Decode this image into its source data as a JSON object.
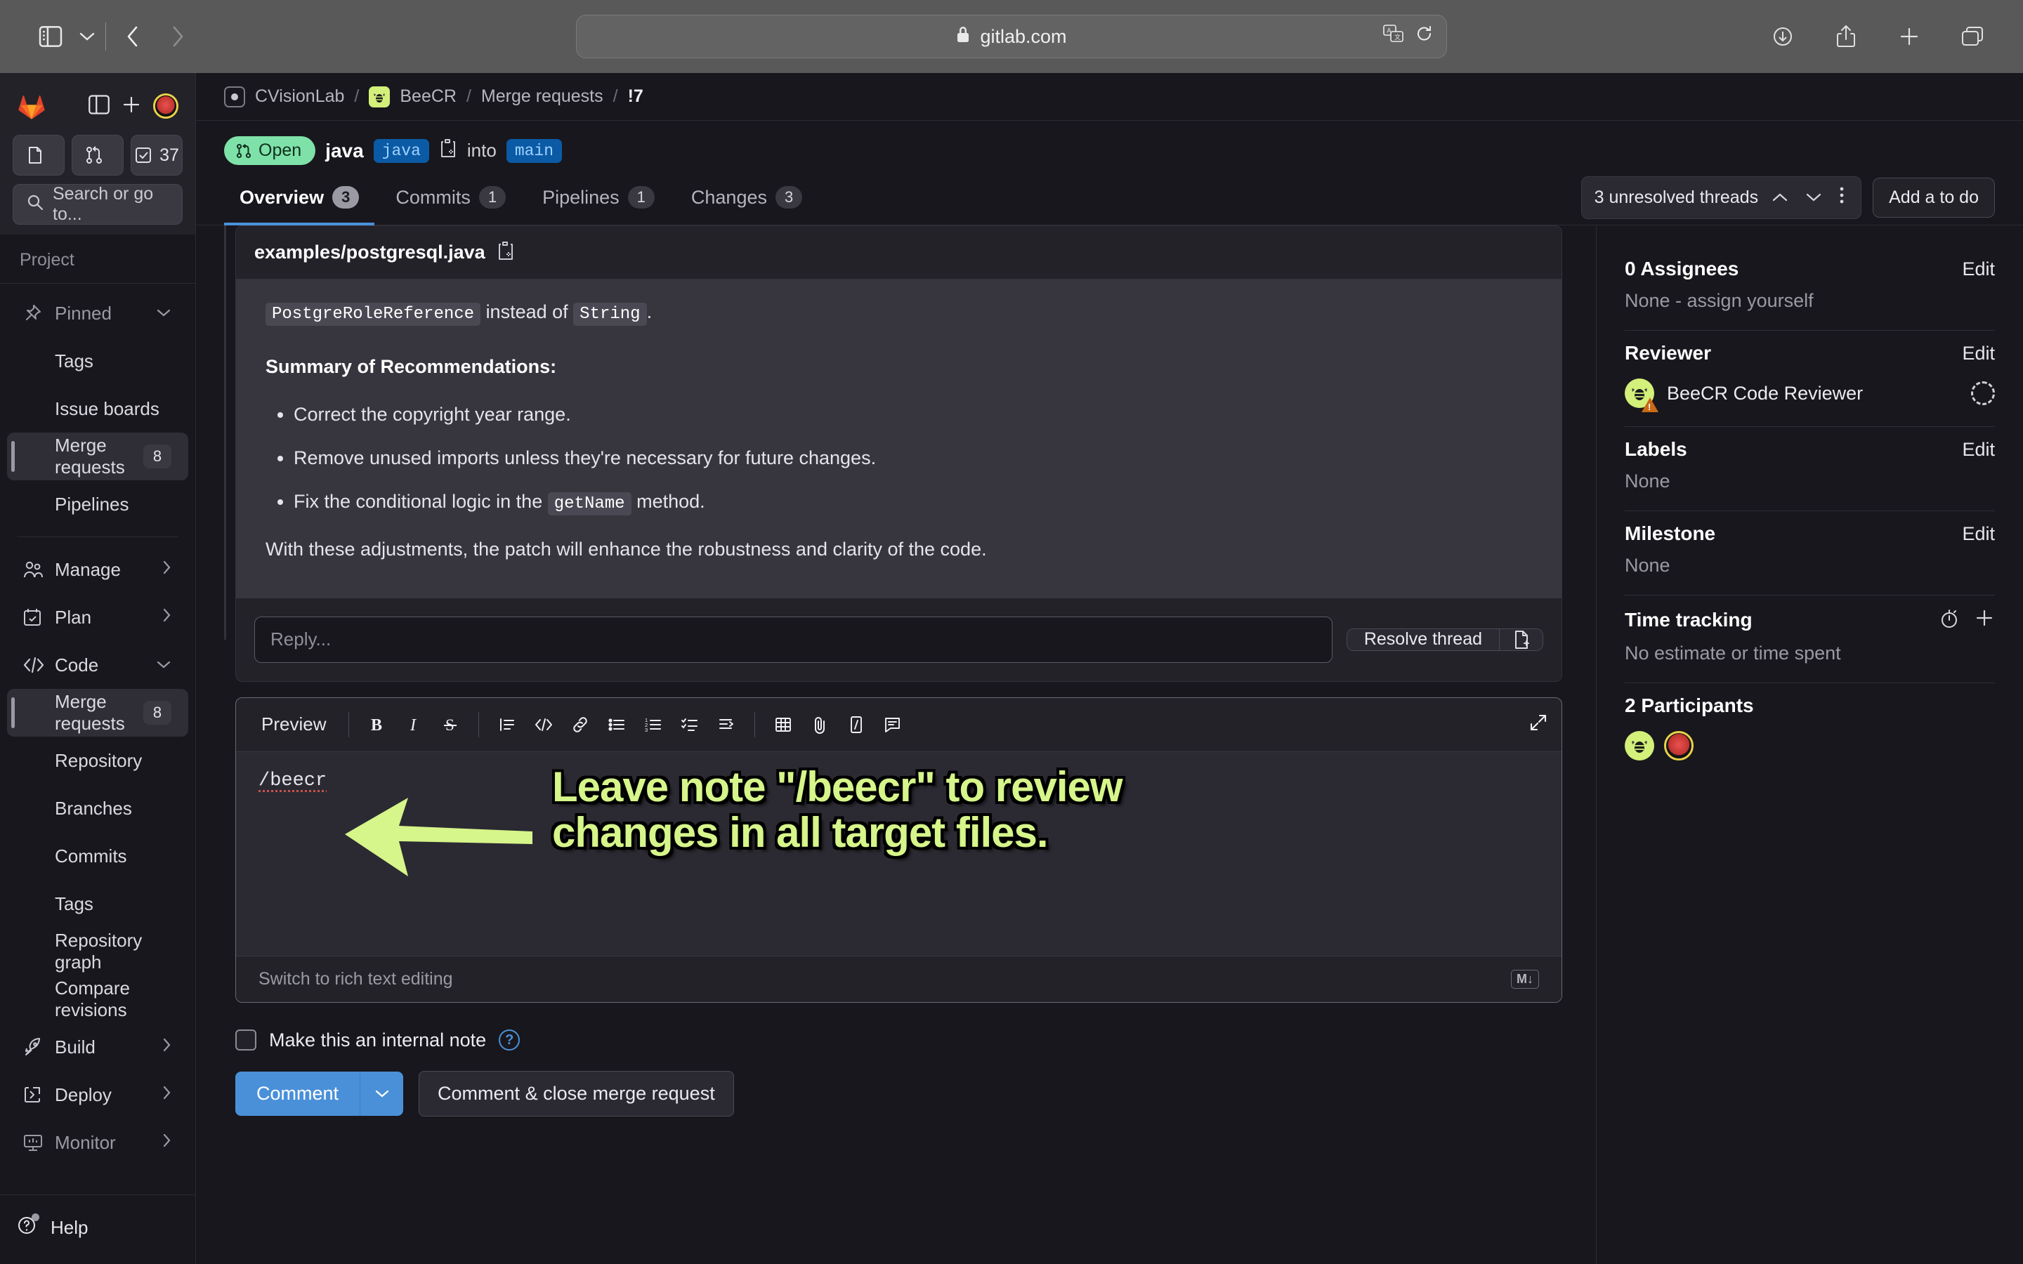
{
  "browser": {
    "url": "gitlab.com",
    "lock_icon": "lock-icon",
    "back_icon": "back-arrow-icon",
    "forward_icon": "forward-arrow-icon",
    "sidebar_toggle_icon": "sidebar-toggle-icon",
    "tab_overview_chevron_icon": "chevron-down-icon",
    "translate_icon": "translate-icon",
    "reload_icon": "reload-icon",
    "downloads_icon": "downloads-icon",
    "share_icon": "share-icon",
    "new_tab_icon": "plus-icon",
    "tabs_icon": "tab-overview-icon"
  },
  "sidebar": {
    "logo_icon": "gitlab-logo-icon",
    "panel_toggle_icon": "panel-toggle-icon",
    "create_new_icon": "plus-icon",
    "avatar_icon": "user-avatar",
    "pills": [
      {
        "name": "issues-pill",
        "icon": "issue-icon",
        "count": ""
      },
      {
        "name": "merge-requests-pill",
        "icon": "merge-request-icon",
        "count": ""
      },
      {
        "name": "todos-pill",
        "icon": "todo-check-icon",
        "count": "37"
      }
    ],
    "search_placeholder": "Search or go to...",
    "search_icon": "search-icon",
    "section_title": "Project",
    "items": [
      {
        "label": "Pinned",
        "icon": "pin-icon",
        "badge": "",
        "chevron": "chevron-down-icon",
        "level": "top",
        "muted": true,
        "active": false
      },
      {
        "label": "Tags",
        "icon": "",
        "badge": "",
        "chevron": "",
        "level": "sub",
        "muted": false,
        "active": false
      },
      {
        "label": "Issue boards",
        "icon": "",
        "badge": "",
        "chevron": "",
        "level": "sub",
        "muted": false,
        "active": false
      },
      {
        "label": "Merge requests",
        "icon": "",
        "badge": "8",
        "chevron": "",
        "level": "sub",
        "muted": false,
        "active": true
      },
      {
        "label": "Pipelines",
        "icon": "",
        "badge": "",
        "chevron": "",
        "level": "sub",
        "muted": false,
        "active": false
      },
      {
        "label": "Manage",
        "icon": "users-icon",
        "badge": "",
        "chevron": "chevron-right-icon",
        "level": "top",
        "muted": false,
        "active": false
      },
      {
        "label": "Plan",
        "icon": "calendar-icon",
        "badge": "",
        "chevron": "chevron-right-icon",
        "level": "top",
        "muted": false,
        "active": false
      },
      {
        "label": "Code",
        "icon": "code-icon",
        "badge": "",
        "chevron": "chevron-down-icon",
        "level": "top",
        "muted": false,
        "active": false
      },
      {
        "label": "Merge requests",
        "icon": "",
        "badge": "8",
        "chevron": "",
        "level": "sub",
        "muted": false,
        "active": true
      },
      {
        "label": "Repository",
        "icon": "",
        "badge": "",
        "chevron": "",
        "level": "sub",
        "muted": false,
        "active": false
      },
      {
        "label": "Branches",
        "icon": "",
        "badge": "",
        "chevron": "",
        "level": "sub",
        "muted": false,
        "active": false
      },
      {
        "label": "Commits",
        "icon": "",
        "badge": "",
        "chevron": "",
        "level": "sub",
        "muted": false,
        "active": false
      },
      {
        "label": "Tags",
        "icon": "",
        "badge": "",
        "chevron": "",
        "level": "sub",
        "muted": false,
        "active": false
      },
      {
        "label": "Repository graph",
        "icon": "",
        "badge": "",
        "chevron": "",
        "level": "sub",
        "muted": false,
        "active": false
      },
      {
        "label": "Compare revisions",
        "icon": "",
        "badge": "",
        "chevron": "",
        "level": "sub",
        "muted": false,
        "active": false
      },
      {
        "label": "Build",
        "icon": "rocket-icon",
        "badge": "",
        "chevron": "chevron-right-icon",
        "level": "top",
        "muted": false,
        "active": false
      },
      {
        "label": "Deploy",
        "icon": "deploy-icon",
        "badge": "",
        "chevron": "chevron-right-icon",
        "level": "top",
        "muted": false,
        "active": false
      },
      {
        "label": "Monitor",
        "icon": "monitor-icon",
        "badge": "",
        "chevron": "chevron-right-icon",
        "level": "top",
        "muted": true,
        "active": false
      }
    ],
    "help_label": "Help",
    "help_icon": "help-circle-icon"
  },
  "breadcrumb": {
    "group": "CVisionLab",
    "project": "BeeCR",
    "section": "Merge requests",
    "current": "!7",
    "separator": "/",
    "group_icon": "project-avatar-icon",
    "project_icon": "bee-avatar-icon"
  },
  "merge_request": {
    "status": "Open",
    "status_icon": "merge-request-open-icon",
    "source_branch_title": "java",
    "source_branch_chip": "java",
    "copy_icon": "copy-branch-icon",
    "into_word": "into",
    "target_branch_chip": "main"
  },
  "tabs": [
    {
      "label": "Overview",
      "count": "3",
      "active": true
    },
    {
      "label": "Commits",
      "count": "1",
      "active": false
    },
    {
      "label": "Pipelines",
      "count": "1",
      "active": false
    },
    {
      "label": "Changes",
      "count": "3",
      "active": false
    }
  ],
  "tabs_right": {
    "threads_text": "3 unresolved threads",
    "prev_icon": "chevron-up-icon",
    "next_icon": "chevron-down-icon",
    "more_icon": "ellipsis-vertical-icon",
    "todo_button": "Add a to do"
  },
  "discussion": {
    "filename": "examples/postgresql.java",
    "copy_icon": "copy-path-icon",
    "paragraph_1_code_1": "PostgreRoleReference",
    "paragraph_1_mid": "instead of",
    "paragraph_1_code_2": "String",
    "paragraph_1_end": ".",
    "summary_heading": "Summary of Recommendations:",
    "bullets": [
      {
        "pre": "Correct the copyright year range.",
        "code": "",
        "post": ""
      },
      {
        "pre": "Remove unused imports unless they're necessary for future changes.",
        "code": "",
        "post": ""
      },
      {
        "pre": "Fix the conditional logic in the",
        "code": "getName",
        "post": "method."
      }
    ],
    "closing": "With these adjustments, the patch will enhance the robustness and clarity of the code.",
    "reply_placeholder": "Reply...",
    "resolve_label": "Resolve thread",
    "resolve_icon": "resolve-to-issue-icon"
  },
  "editor": {
    "preview_label": "Preview",
    "toolbar_icons": [
      "bold-icon",
      "italic-icon",
      "strikethrough-icon",
      "quote-icon",
      "code-icon",
      "link-icon",
      "bullet-list-icon",
      "numbered-list-icon",
      "task-list-icon",
      "indent-icon",
      "table-icon",
      "attachment-icon",
      "snippet-icon",
      "comment-template-icon"
    ],
    "expand_icon": "expand-fullscreen-icon",
    "content": "/beecr",
    "footer_label": "Switch to rich text editing",
    "markdown_badge": "M↓"
  },
  "annotation": {
    "line1": "Leave note \"/beecr\" to review",
    "line2": "changes in all target files.",
    "arrow_icon": "left-arrow-annotation",
    "color": "#d6f58a"
  },
  "post_controls": {
    "internal_note_label": "Make this an internal note",
    "help_icon": "help-circle-icon",
    "comment_label": "Comment",
    "comment_caret_icon": "chevron-down-icon",
    "close_mr_label": "Comment & close merge request"
  },
  "right_panel": {
    "sections": [
      {
        "title": "0 Assignees",
        "action": "Edit",
        "value": "None - assign yourself",
        "type": "text"
      },
      {
        "title": "Reviewer",
        "action": "Edit",
        "value": "BeeCR Code Reviewer",
        "type": "reviewer"
      },
      {
        "title": "Labels",
        "action": "Edit",
        "value": "None",
        "type": "text"
      },
      {
        "title": "Milestone",
        "action": "Edit",
        "value": "None",
        "type": "text"
      },
      {
        "title": "Time tracking",
        "action": "",
        "value": "No estimate or time spent",
        "type": "time"
      },
      {
        "title": "2 Participants",
        "action": "",
        "value": "",
        "type": "participants"
      }
    ],
    "timer_icon": "stopwatch-icon",
    "add_icon": "plus-icon",
    "reviewer_status_icon": "dashed-circle-icon"
  },
  "colors": {
    "accent_blue": "#4a90d9",
    "open_green": "#7ee2a8",
    "bee_green": "#d2f07a",
    "branch_blue": "#0b5aa5"
  }
}
